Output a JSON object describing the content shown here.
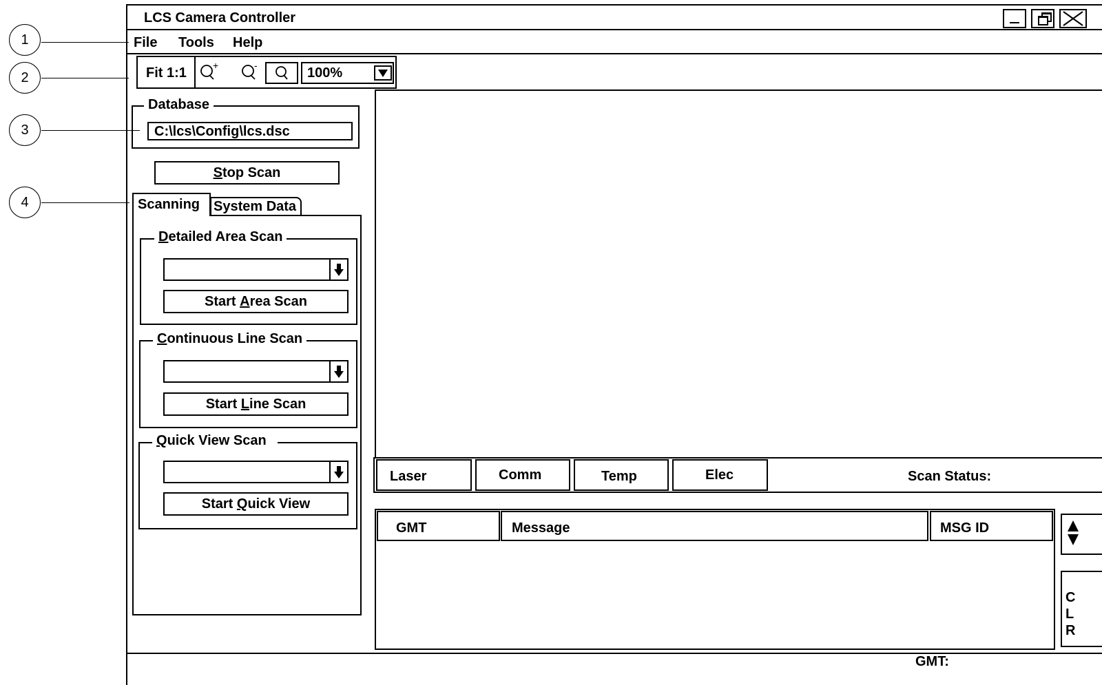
{
  "callouts": [
    "1",
    "2",
    "3",
    "4"
  ],
  "window": {
    "title": "LCS Camera Controller",
    "controls": [
      "minimize-icon",
      "restore-icon",
      "close-icon"
    ]
  },
  "menu": [
    {
      "label": "File"
    },
    {
      "label": "Tools"
    },
    {
      "label": "Help"
    }
  ],
  "toolbar": {
    "fit": "Fit 1:1",
    "zoom_in_icon": "zoom-in-icon",
    "zoom_out_icon": "zoom-out-icon",
    "zoom_icon": "zoom-icon",
    "zoom_value": "100%"
  },
  "database": {
    "legend": "Database",
    "path": "C:\\lcs\\Config\\lcs.dsc"
  },
  "stop_scan": {
    "mnemonic": "S",
    "rest": "top Scan"
  },
  "tabs": [
    {
      "label": "Scanning",
      "active": true
    },
    {
      "label": "System Data",
      "active": false
    }
  ],
  "detailed_area_scan": {
    "legend_mnemonic": "D",
    "legend_rest": "etailed Area Scan",
    "select_value": "",
    "button_pre": "Start ",
    "button_mnemonic": "A",
    "button_post": "rea Scan"
  },
  "continuous_line_scan": {
    "legend_mnemonic": "C",
    "legend_rest": "ontinuous Line Scan",
    "select_value": "",
    "button_pre": "Start ",
    "button_mnemonic": "L",
    "button_post": "ine Scan"
  },
  "quick_view_scan": {
    "legend_mnemonic": "Q",
    "legend_rest": "uick View Scan",
    "select_value": "",
    "button_pre": "Start ",
    "button_mnemonic": "Q",
    "button_post": "uick View"
  },
  "status_bar": {
    "indicators": [
      "Laser",
      "Comm",
      "Temp",
      "Elec"
    ],
    "scan_status_label": "Scan Status:"
  },
  "message_log": {
    "columns": [
      "GMT",
      "Message",
      "MSG ID"
    ],
    "rows": [],
    "clear_letters": [
      "C",
      "L",
      "R"
    ]
  },
  "footer": {
    "gmt_label": "GMT:"
  }
}
